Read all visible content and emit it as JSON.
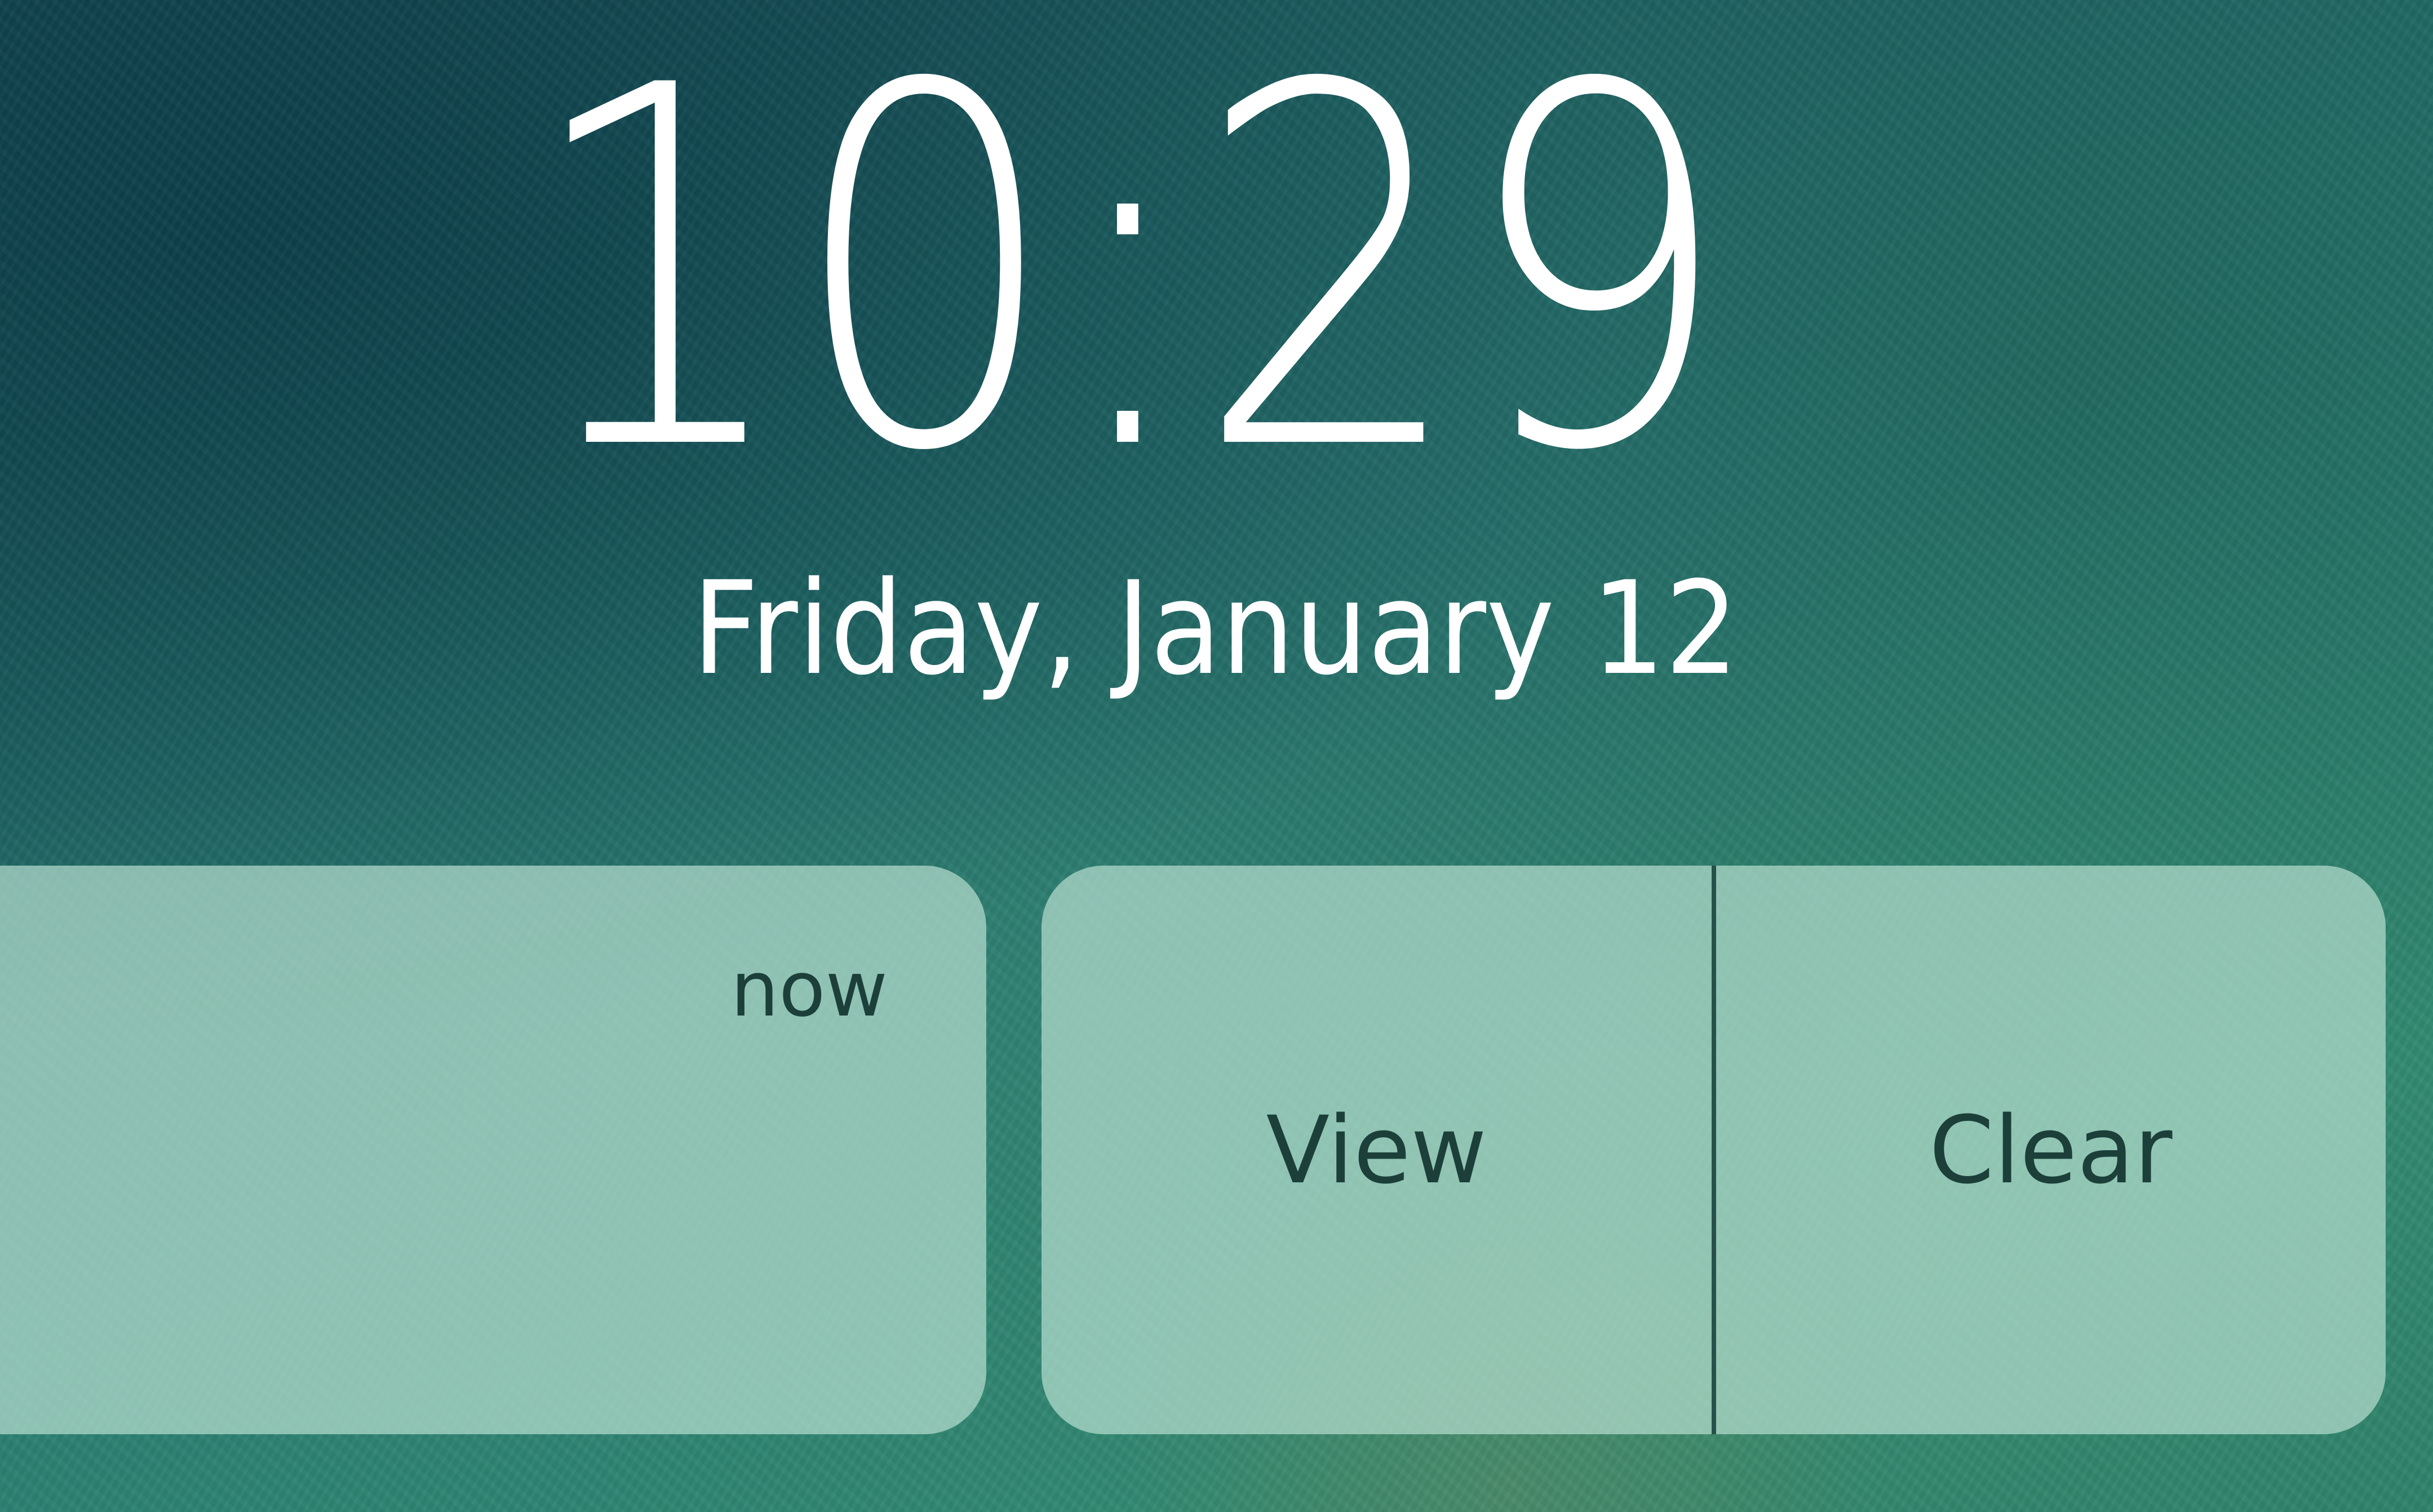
{
  "lock_screen": {
    "time": "10:29",
    "date": "Friday, January 12"
  },
  "notification": {
    "timestamp": "now"
  },
  "actions": {
    "view_label": "View",
    "clear_label": "Clear"
  },
  "colors": {
    "text_primary": "#ffffff",
    "panel_text": "#1c3f3a",
    "panel_background": "#b4dccd"
  }
}
